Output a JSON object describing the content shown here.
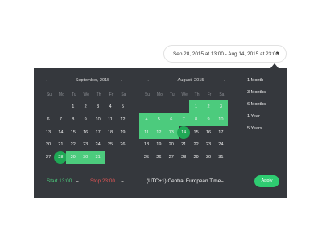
{
  "range": {
    "label": "Sep 28, 2015 at 13:00 - Aug 14, 2015 at 23:00"
  },
  "calendars": [
    {
      "title": "September, 2015",
      "prev": "←",
      "next": "→",
      "dow": [
        "Su",
        "Mo",
        "Tu",
        "We",
        "Th",
        "Fr",
        "Sa"
      ],
      "rows": [
        [
          "",
          "",
          "1",
          "2",
          "3",
          "4",
          "5"
        ],
        [
          "6",
          "7",
          "8",
          "9",
          "10",
          "11",
          "12"
        ],
        [
          "13",
          "14",
          "15",
          "16",
          "17",
          "18",
          "19"
        ],
        [
          "20",
          "21",
          "22",
          "23",
          "24",
          "25",
          "26"
        ],
        [
          "27",
          "28",
          "29",
          "30",
          "31",
          "",
          ""
        ]
      ],
      "selected": [
        "28",
        "29",
        "30",
        "31"
      ],
      "edge": [
        "28"
      ]
    },
    {
      "title": "August, 2015",
      "prev": "←",
      "next": "→",
      "dow": [
        "Su",
        "Mo",
        "Tu",
        "We",
        "Th",
        "Fr",
        "Sa"
      ],
      "rows": [
        [
          "",
          "",
          "",
          "",
          "1",
          "2",
          "3"
        ],
        [
          "4",
          "5",
          "6",
          "7",
          "8",
          "9",
          "10"
        ],
        [
          "11",
          "12",
          "13",
          "14",
          "15",
          "16",
          "17"
        ],
        [
          "18",
          "19",
          "20",
          "21",
          "22",
          "23",
          "24"
        ],
        [
          "25",
          "26",
          "27",
          "28",
          "29",
          "30",
          "31"
        ]
      ],
      "selected": [
        "1",
        "2",
        "3",
        "4",
        "5",
        "6",
        "7",
        "8",
        "9",
        "10",
        "11",
        "12",
        "13",
        "14"
      ],
      "edge": [
        "14"
      ]
    }
  ],
  "presets": [
    "1 Month",
    "3 Months",
    "6 Months",
    "1 Year",
    "5 Years"
  ],
  "footer": {
    "start": "Start 13:00",
    "stop": "Stop 23:00",
    "timezone": "(UTC+1) Central European Time",
    "apply": "Apply"
  },
  "colors": {
    "panel": "#35383d",
    "range": "#4ccb7d",
    "edge": "#1fa855",
    "apply": "#2ecc71",
    "stop": "#e25555"
  }
}
